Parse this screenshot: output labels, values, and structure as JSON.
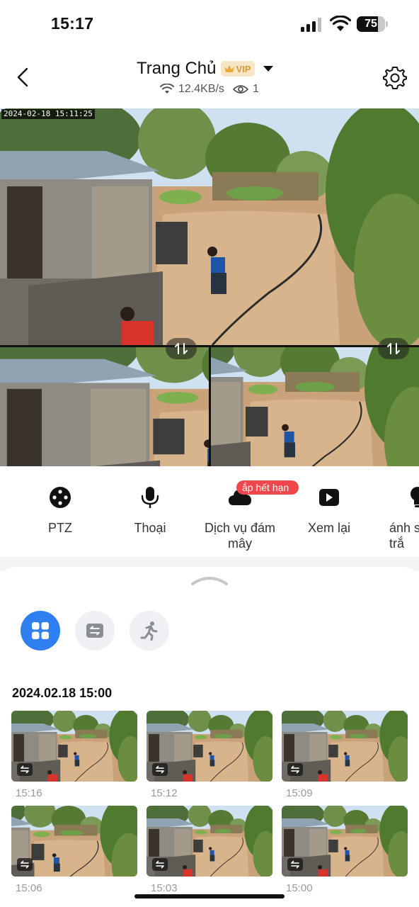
{
  "status_bar": {
    "time": "15:17",
    "battery_level": "75",
    "signal_icon": "cellular-signal-icon",
    "wifi_icon": "wifi-icon"
  },
  "header": {
    "title": "Trang Chủ",
    "vip_label": "VIP",
    "speed": "12.4KB/s",
    "viewers": "1"
  },
  "video": {
    "timestamp": "2024-02-18  15:11:25"
  },
  "toolbar": {
    "items": [
      {
        "label": "PTZ",
        "icon": "ptz-icon"
      },
      {
        "label": "Thoại",
        "icon": "microphone-icon"
      },
      {
        "label": "Dịch vụ đám mây",
        "icon": "cloud-icon"
      },
      {
        "label": "Xem lại",
        "icon": "playback-icon"
      },
      {
        "label": "ánh s trắ",
        "icon": "light-bulb-icon"
      }
    ],
    "cloud_badge": "ắp hết hạn"
  },
  "sheet": {
    "group_date": "2024.02.18 15:00",
    "filters": [
      "grid-view-icon",
      "swap-event-icon",
      "motion-icon"
    ],
    "clips": [
      {
        "time": "15:16"
      },
      {
        "time": "15:12"
      },
      {
        "time": "15:09"
      },
      {
        "time": "15:06"
      },
      {
        "time": "15:03"
      },
      {
        "time": "15:00"
      }
    ]
  },
  "colors": {
    "accent": "#2f7ff0",
    "badge_red": "#f0464c",
    "vip_gold": "#d69a36"
  }
}
